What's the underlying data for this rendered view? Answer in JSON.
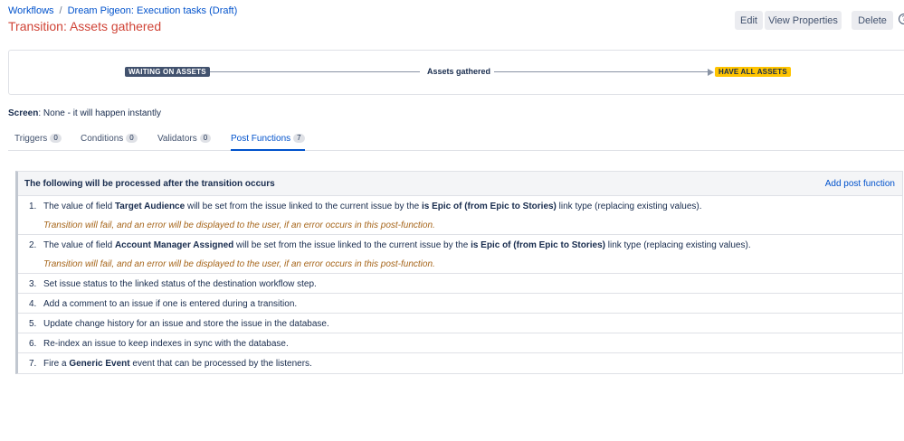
{
  "breadcrumb": {
    "item1": "Workflows",
    "separator": "/",
    "item2": "Dream Pigeon: Execution tasks (Draft)"
  },
  "page_title": "Transition: Assets gathered",
  "buttons": {
    "edit": "Edit",
    "view_properties": "View Properties",
    "delete": "Delete"
  },
  "flow": {
    "from_status": "WAITING ON ASSETS",
    "transition": "Assets gathered",
    "to_status": "HAVE ALL ASSETS"
  },
  "screen": {
    "label": "Screen",
    "value": ": None - it will happen instantly"
  },
  "tabs": [
    {
      "label": "Triggers",
      "count": "0"
    },
    {
      "label": "Conditions",
      "count": "0"
    },
    {
      "label": "Validators",
      "count": "0"
    },
    {
      "label": "Post Functions",
      "count": "7"
    }
  ],
  "post_functions": {
    "header": "The following will be processed after the transition occurs",
    "add_link": "Add post function",
    "items": [
      {
        "num": "1.",
        "p1": "The value of field ",
        "b1": "Target Audience",
        "p2": " will be set from the issue linked to the current issue by the ",
        "b2": "is Epic of (from Epic to Stories)",
        "p3": " link type (replacing existing values).",
        "warning": "Transition will fail, and an error will be displayed to the user, if an error occurs in this post-function."
      },
      {
        "num": "2.",
        "p1": "The value of field ",
        "b1": "Account Manager Assigned",
        "p2": " will be set from the issue linked to the current issue by the ",
        "b2": "is Epic of (from Epic to Stories)",
        "p3": " link type (replacing existing values).",
        "warning": "Transition will fail, and an error will be displayed to the user, if an error occurs in this post-function."
      },
      {
        "num": "3.",
        "text": "Set issue status to the linked status of the destination workflow step."
      },
      {
        "num": "4.",
        "text": "Add a comment to an issue if one is entered during a transition."
      },
      {
        "num": "5.",
        "text": "Update change history for an issue and store the issue in the database."
      },
      {
        "num": "6.",
        "text": "Re-index an issue to keep indexes in sync with the database."
      },
      {
        "num": "7.",
        "p1": "Fire a ",
        "b1": "Generic Event",
        "p2": " event that can be processed by the listeners."
      }
    ]
  },
  "icons": {
    "help": "help-icon"
  },
  "colors": {
    "link": "#0052cc",
    "title": "#d04437",
    "from_lozenge": "#42526e",
    "to_lozenge": "#ffc400",
    "warning_text": "#a6651a"
  }
}
